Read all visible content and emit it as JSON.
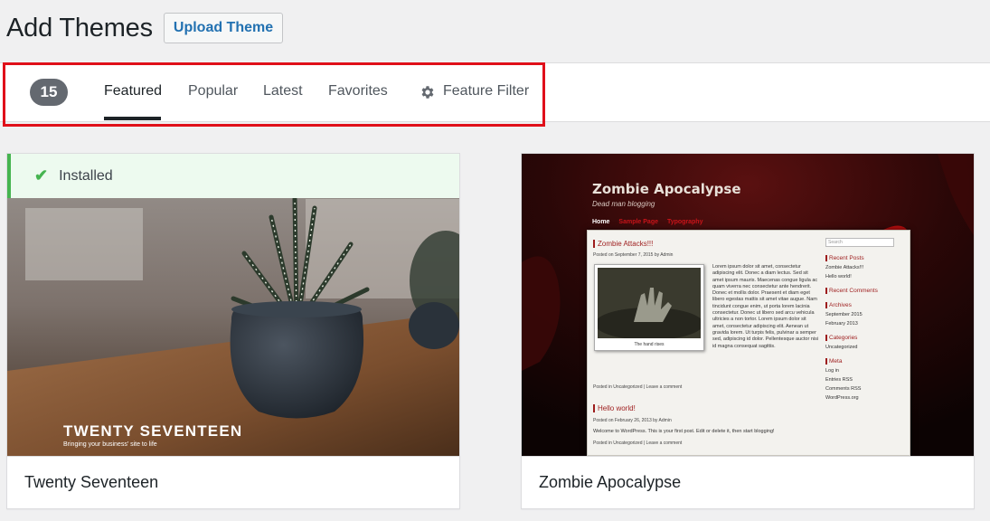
{
  "header": {
    "title": "Add Themes",
    "upload_label": "Upload Theme"
  },
  "filter_bar": {
    "count": "15",
    "tabs": [
      {
        "label": "Featured",
        "active": true
      },
      {
        "label": "Popular",
        "active": false
      },
      {
        "label": "Latest",
        "active": false
      },
      {
        "label": "Favorites",
        "active": false
      }
    ],
    "feature_filter_label": "Feature Filter",
    "feature_filter_icon": "gear-icon",
    "highlight_color": "#e0101a"
  },
  "themes": [
    {
      "name": "Twenty Seventeen",
      "installed_label": "Installed",
      "screenshot": {
        "title": "TWENTY SEVENTEEN",
        "subtitle": "Bringing your business' site to life"
      }
    },
    {
      "name": "Zombie Apocalypse",
      "screenshot": {
        "title": "Zombie Apocalypse",
        "tagline": "Dead man blogging",
        "nav": [
          "Home",
          "Sample Page",
          "Typography"
        ],
        "post1_title": "Zombie Attacks!!!",
        "post1_meta": "Posted on September 7, 2015 by Admin",
        "post1_body": "Lorem ipsum dolor sit amet, consectetur adipiscing elit. Donec a diam lectus. Sed sit amet ipsum mauris. Maecenas congue ligula ac quam viverra nec consectetur ante hendrerit. Donec et mollis dolor. Praesent et diam eget libero egestas mattis sit amet vitae augue. Nam tincidunt congue enim, ut porta lorem lacinia consectetur. Donec ut libero sed arcu vehicula ultricies a non tortor. Lorem ipsum dolor sit amet, consectetur adipiscing elit. Aenean ut gravida lorem. Ut turpis felis, pulvinar a semper sed, adipiscing id dolor. Pellentesque auctor nisi id magna consequat sagittis.",
        "photo_caption": "The hand rises",
        "post1_footer": "Posted in Uncategorized | Leave a comment",
        "post2_title": "Hello world!",
        "post2_meta": "Posted on February 26, 2013 by Admin",
        "post2_body": "Welcome to WordPress. This is your first post. Edit or delete it, then start blogging!",
        "post2_footer": "Posted in Uncategorized | Leave a comment",
        "sidebar": {
          "search_placeholder": "Search",
          "recent_posts_heading": "Recent Posts",
          "recent_posts": [
            "Zombie Attacks!!!",
            "Hello world!"
          ],
          "recent_comments_heading": "Recent Comments",
          "archives_heading": "Archives",
          "archives": [
            "September 2015",
            "February 2013"
          ],
          "categories_heading": "Categories",
          "categories": [
            "Uncategorized"
          ],
          "meta_heading": "Meta",
          "meta": [
            "Log in",
            "Entries RSS",
            "Comments RSS",
            "WordPress.org"
          ]
        }
      }
    }
  ],
  "colors": {
    "accent": "#2271b1",
    "installed_green": "#46b450",
    "zombie_red": "#9d1c1c"
  }
}
